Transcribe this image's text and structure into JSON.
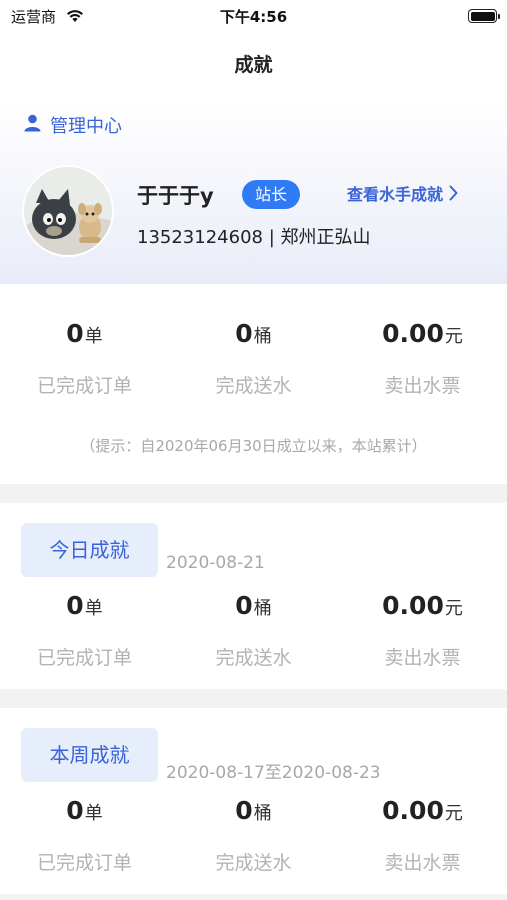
{
  "status_bar": {
    "carrier": "运营商",
    "time": "下午4:56"
  },
  "nav": {
    "title": "成就"
  },
  "profile": {
    "management_label": "管理中心",
    "name": "于于于y",
    "role": "站长",
    "view_link": "查看水手成就",
    "info": "13523124608 | 郑州正弘山"
  },
  "total": {
    "stats": [
      {
        "value": "0",
        "unit": "单",
        "label": "已完成订单"
      },
      {
        "value": "0",
        "unit": "桶",
        "label": "完成送水"
      },
      {
        "value": "0.00",
        "unit": "元",
        "label": "卖出水票"
      }
    ],
    "hint": "（提示：自2020年06月30日成立以来，本站累计）"
  },
  "today": {
    "title": "今日成就",
    "date": "2020-08-21",
    "stats": [
      {
        "value": "0",
        "unit": "单",
        "label": "已完成订单"
      },
      {
        "value": "0",
        "unit": "桶",
        "label": "完成送水"
      },
      {
        "value": "0.00",
        "unit": "元",
        "label": "卖出水票"
      }
    ]
  },
  "week": {
    "title": "本周成就",
    "date": "2020-08-17至2020-08-23",
    "stats": [
      {
        "value": "0",
        "unit": "单",
        "label": "已完成订单"
      },
      {
        "value": "0",
        "unit": "桶",
        "label": "完成送水"
      },
      {
        "value": "0.00",
        "unit": "元",
        "label": "卖出水票"
      }
    ]
  },
  "colors": {
    "accent": "#3a63d8",
    "badge": "#2f7bf6",
    "muted": "#b3b3b3",
    "tag_bg": "#e6edfb"
  }
}
